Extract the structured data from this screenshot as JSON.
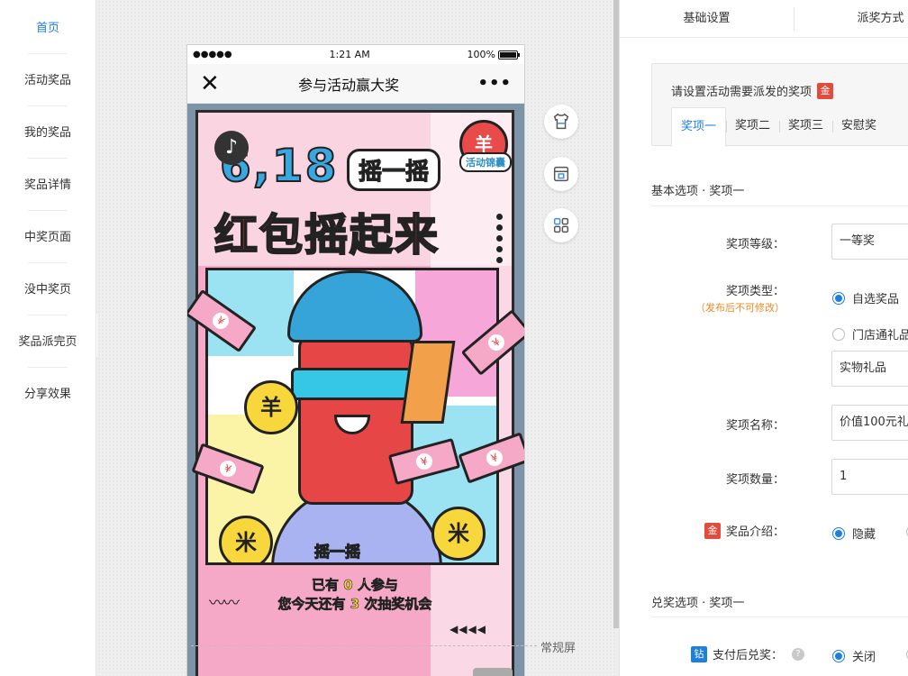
{
  "sidebar": {
    "items": [
      {
        "label": "首页"
      },
      {
        "label": "活动奖品"
      },
      {
        "label": "我的奖品"
      },
      {
        "label": "奖品详情"
      },
      {
        "label": "中奖页面"
      },
      {
        "label": "没中奖页"
      },
      {
        "label": "奖品派完页"
      },
      {
        "label": "分享效果"
      }
    ],
    "collapse_icon": "«"
  },
  "phone": {
    "status_time": "1:21 AM",
    "status_signal": "●●●●●",
    "status_battery": "100%",
    "title": "参与活动赢大奖",
    "close_icon": "✕",
    "more_icon": "•••"
  },
  "poster": {
    "music_icon": "♪",
    "title_618": "6,18",
    "shake_bubble": "摇一摇",
    "badge_symbol": "羊",
    "badge_label": "活动锦囊",
    "headline": "红包摇起来",
    "coin_symbol": "羊",
    "coin_symbol_alt": "米",
    "shake_tag": "摇一摇",
    "participants": "已有 0 人参与",
    "chances": "您今天还有 3 次抽奖机会",
    "zigzag": "〰〰",
    "arrows": "◀◀◀◀"
  },
  "canvas": {
    "fold_label": "常规屏"
  },
  "tools": [
    {
      "name": "theme-icon"
    },
    {
      "name": "store-icon"
    },
    {
      "name": "apps-icon"
    }
  ],
  "panel": {
    "tabs": [
      {
        "label": "基础设置"
      },
      {
        "label": "派奖方式"
      }
    ],
    "award_prompt": "请设置活动需要派发的奖项",
    "gold_badge": "金",
    "award_tabs": [
      {
        "label": "奖项一"
      },
      {
        "label": "奖项二"
      },
      {
        "label": "奖项三"
      },
      {
        "label": "安慰奖"
      }
    ],
    "basic_section": "基本选项 · 奖项一",
    "level_label": "奖项等级：",
    "level_value": "一等奖",
    "type_label": "奖项类型：",
    "type_note": "（发布后不可修改）",
    "type_option_1": "自选奖品",
    "type_option_2": "门店通礼品",
    "type_select_value": "实物礼品",
    "name_label": "奖项名称：",
    "name_value": "价值100元礼",
    "count_label": "奖项数量：",
    "count_value": "1",
    "intro_label": "奖品介绍：",
    "intro_option": "隐藏",
    "redeem_section": "兑奖选项 · 奖项一",
    "diamond_badge": "钻",
    "pay_redeem_label": "支付后兑奖：",
    "help_icon": "?",
    "pay_redeem_option": "关闭"
  }
}
